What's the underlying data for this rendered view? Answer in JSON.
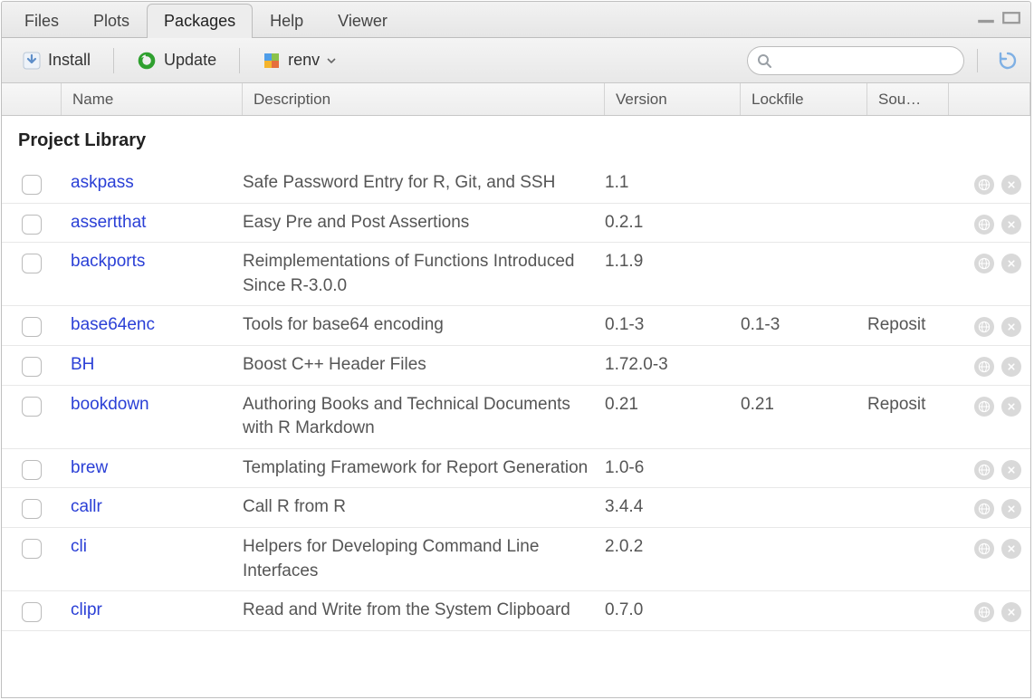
{
  "tabs": [
    {
      "label": "Files",
      "active": false
    },
    {
      "label": "Plots",
      "active": false
    },
    {
      "label": "Packages",
      "active": true
    },
    {
      "label": "Help",
      "active": false
    },
    {
      "label": "Viewer",
      "active": false
    }
  ],
  "toolbar": {
    "install_label": "Install",
    "update_label": "Update",
    "renv_label": "renv",
    "search_placeholder": ""
  },
  "columns": {
    "name": "Name",
    "description": "Description",
    "version": "Version",
    "lockfile": "Lockfile",
    "source": "Sou…"
  },
  "section_title": "Project Library",
  "packages": [
    {
      "name": "askpass",
      "description": "Safe Password Entry for R, Git, and SSH",
      "version": "1.1",
      "lockfile": "",
      "source": ""
    },
    {
      "name": "assertthat",
      "description": "Easy Pre and Post Assertions",
      "version": "0.2.1",
      "lockfile": "",
      "source": ""
    },
    {
      "name": "backports",
      "description": "Reimplementations of Functions Introduced Since R-3.0.0",
      "version": "1.1.9",
      "lockfile": "",
      "source": ""
    },
    {
      "name": "base64enc",
      "description": "Tools for base64 encoding",
      "version": "0.1-3",
      "lockfile": "0.1-3",
      "source": "Reposit"
    },
    {
      "name": "BH",
      "description": "Boost C++ Header Files",
      "version": "1.72.0-3",
      "lockfile": "",
      "source": ""
    },
    {
      "name": "bookdown",
      "description": "Authoring Books and Technical Documents with R Markdown",
      "version": "0.21",
      "lockfile": "0.21",
      "source": "Reposit"
    },
    {
      "name": "brew",
      "description": "Templating Framework for Report Generation",
      "version": "1.0-6",
      "lockfile": "",
      "source": ""
    },
    {
      "name": "callr",
      "description": "Call R from R",
      "version": "3.4.4",
      "lockfile": "",
      "source": ""
    },
    {
      "name": "cli",
      "description": "Helpers for Developing Command Line Interfaces",
      "version": "2.0.2",
      "lockfile": "",
      "source": ""
    },
    {
      "name": "clipr",
      "description": "Read and Write from the System Clipboard",
      "version": "0.7.0",
      "lockfile": "",
      "source": ""
    }
  ]
}
